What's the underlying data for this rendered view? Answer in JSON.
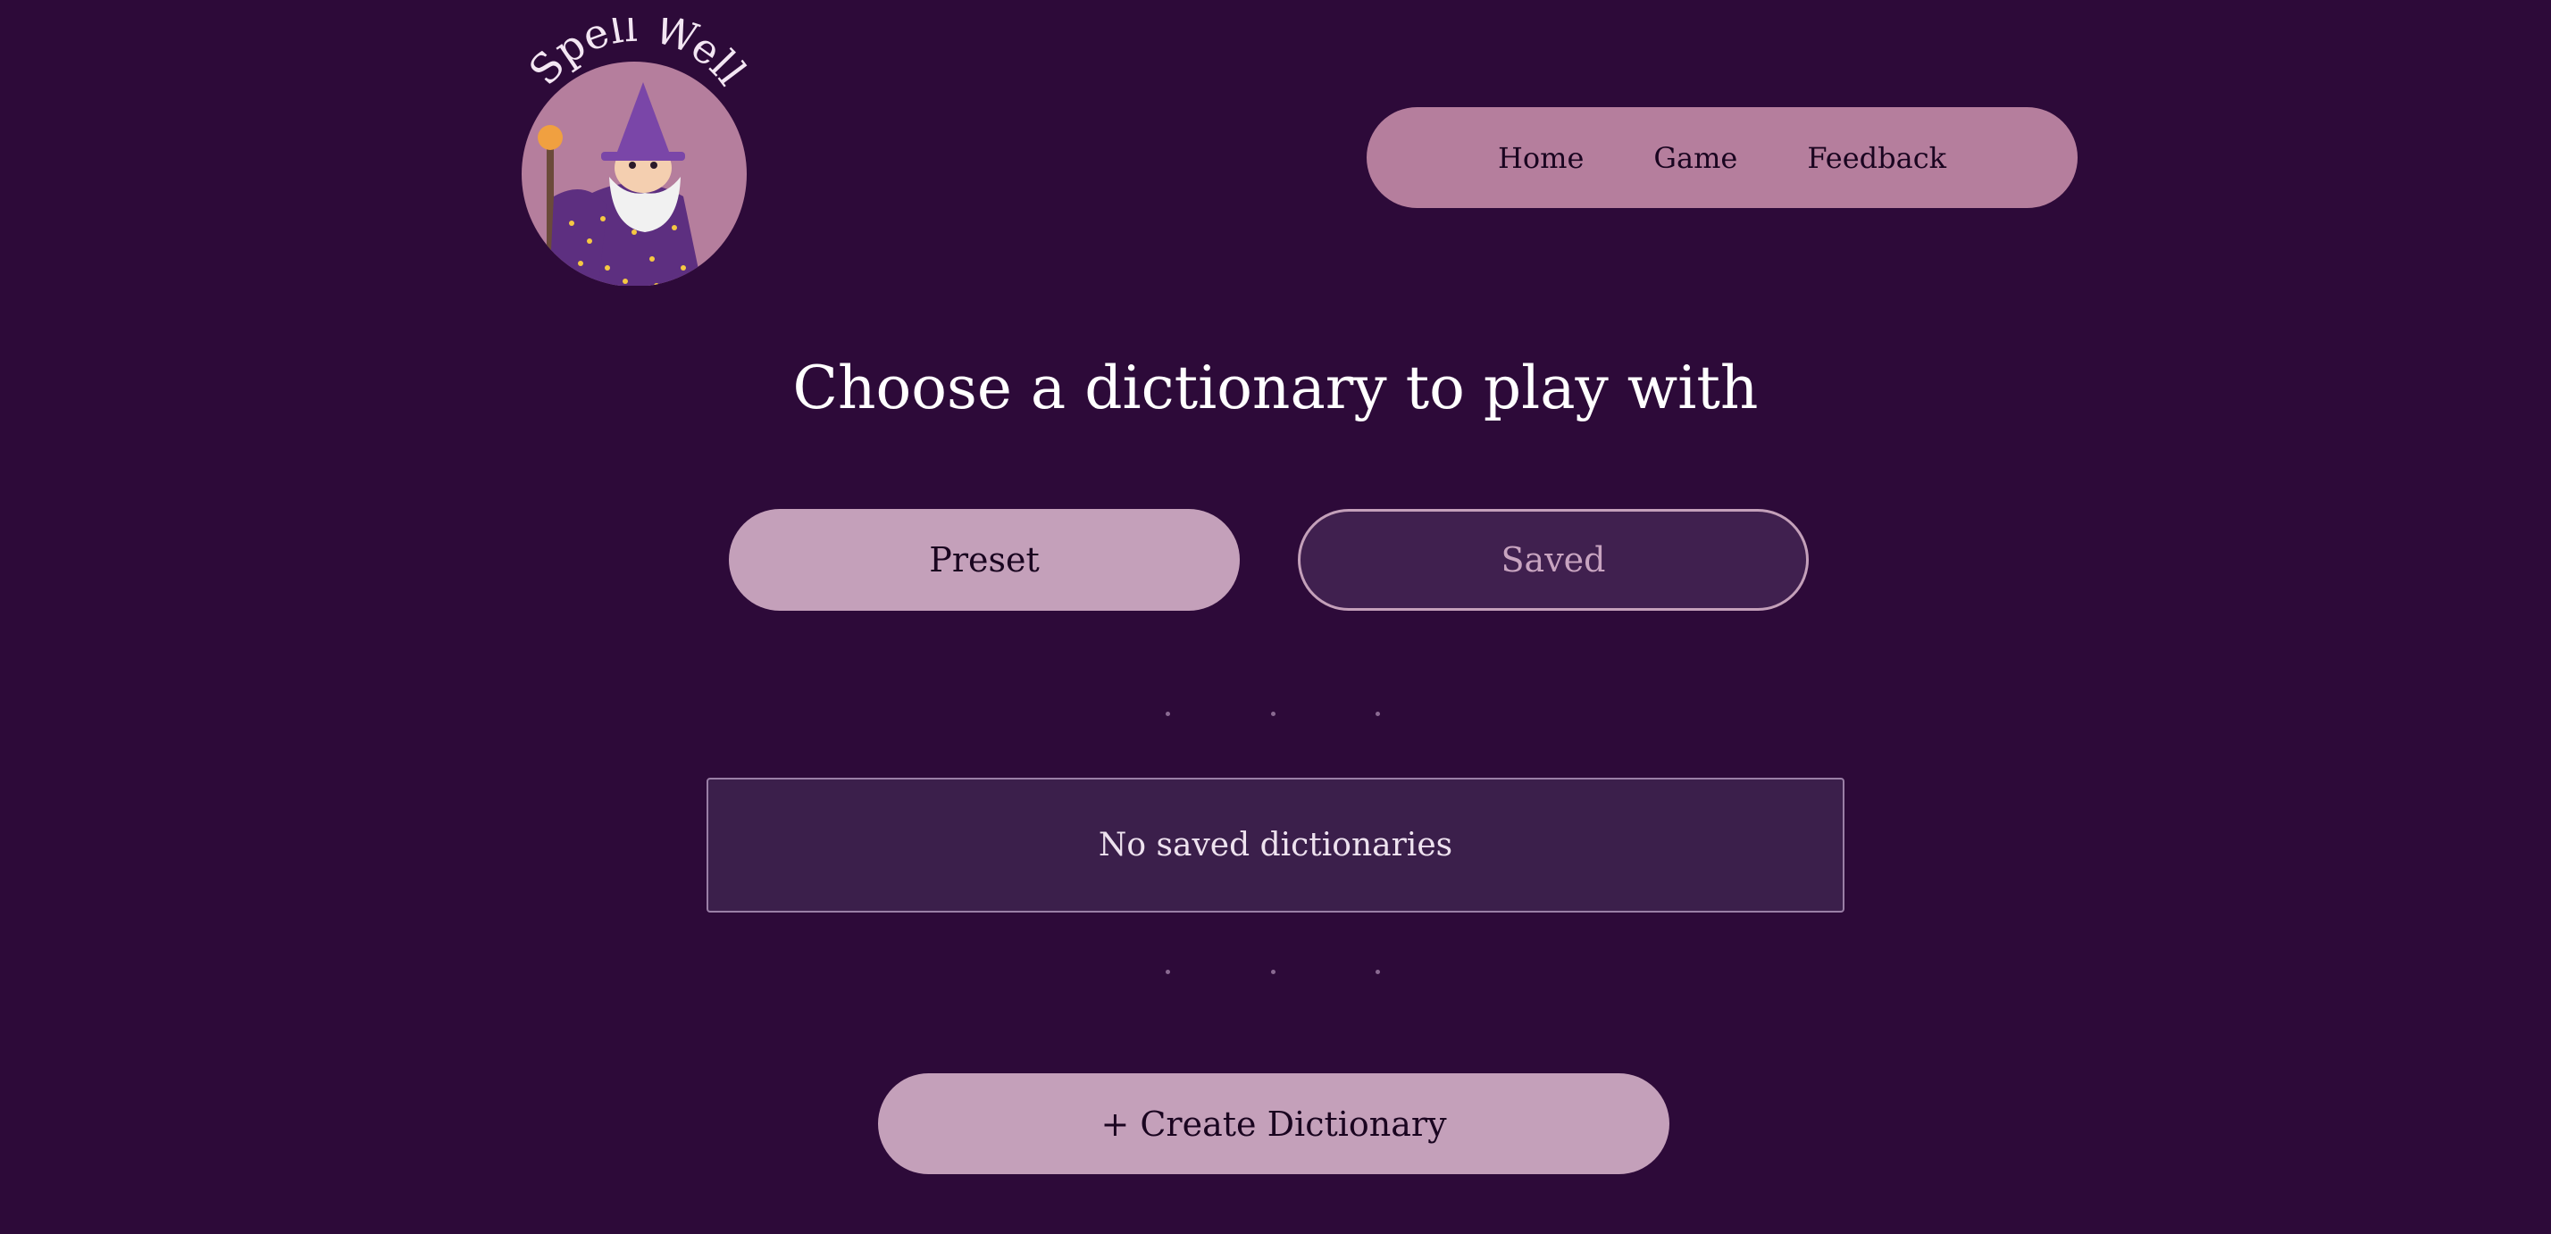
{
  "brand": {
    "logo_text": "Spell Well"
  },
  "nav": {
    "items": [
      "Home",
      "Game",
      "Feedback"
    ]
  },
  "main": {
    "title": "Choose a dictionary to play with",
    "tabs": [
      {
        "label": "Preset",
        "selected": true
      },
      {
        "label": "Saved",
        "selected": false
      }
    ],
    "empty_message": "No saved dictionaries",
    "create_label": "+ Create Dictionary"
  },
  "colors": {
    "background": "#2d0a39",
    "nav_bg": "#b57e9d",
    "button_bg": "#c4a0ba",
    "panel_bg": "#3b1f4b"
  }
}
